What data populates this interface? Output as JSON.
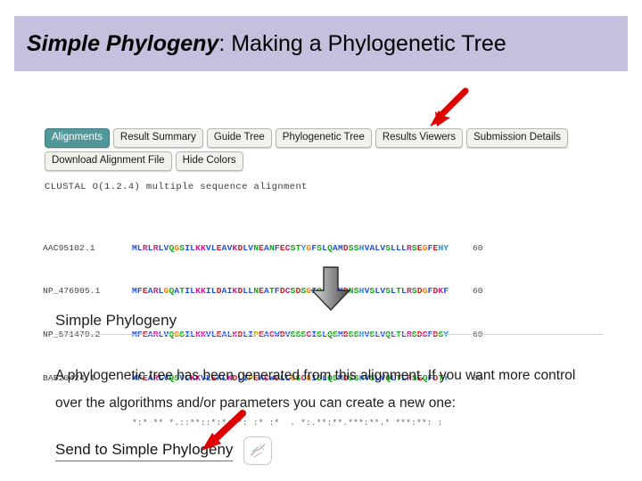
{
  "slide": {
    "title_emphasis": "Simple Phylogeny",
    "title_rest": ": Making a Phylogenetic Tree",
    "banner_color": "#c6bfdd"
  },
  "result_page": {
    "tabs": [
      {
        "label": "Alignments",
        "active": true
      },
      {
        "label": "Result Summary",
        "active": false
      },
      {
        "label": "Guide Tree",
        "active": false
      },
      {
        "label": "Phylogenetic Tree",
        "active": false
      },
      {
        "label": "Results Viewers",
        "active": false
      },
      {
        "label": "Submission Details",
        "active": false
      }
    ],
    "active_tab_color": "#52989a",
    "actions": [
      {
        "label": "Download Alignment File"
      },
      {
        "label": "Hide Colors"
      }
    ],
    "clustal_header": "CLUSTAL O(1.2.4) multiple sequence alignment",
    "alignment": {
      "rows": [
        {
          "id": "AAC95102.1",
          "sequence": "MLRLRLVQGSILKKVLEAVKDLVNEANFECSTYGFSLQAMDSSHVALVSLLLRSEGFEHY",
          "position": "60"
        },
        {
          "id": "NP_476905.1",
          "sequence": "MFEARLGQATILKKILDAIKDLLNEATFDCSDSGIQLQAMDNSHVSLVSLTLRSDGFDKF",
          "position": "60"
        },
        {
          "id": "NP_571479.2",
          "sequence": "MFEARLVQGSILKKVLEALKDLIPEACWDVSSSCISLQSMDSSHVSLVQLTLRSDCFDSY",
          "position": "60"
        },
        {
          "id": "BAB20424.1",
          "sequence": "MFEARLVQSVLKKVLEALKDLIPEACWDLLGSCGISLQSMDSSHVSLVQLTLRSEQFDTY",
          "position": "60"
        }
      ],
      "conservation": "*:* ** *.::**::*:*:**: :* :*  . *:.**:**.***:**.* ***:**: :"
    }
  },
  "phylogeny_section": {
    "heading": "Simple Phylogeny",
    "paragraph": "A phylogenetic tree has been generated from this alignment. If you want more control over the algorithms and/or parameters you can create a new one:",
    "send_link": "Send to Simple Phylogeny",
    "send_icon_name": "phylogenetic-tree-icon"
  },
  "annotations": {
    "arrow_color": "#e00000",
    "down_arrow_color": "#8c8c8c",
    "top_arrow_target": "Results Viewers",
    "bottom_arrow_target": "Send to Simple Phylogeny"
  }
}
